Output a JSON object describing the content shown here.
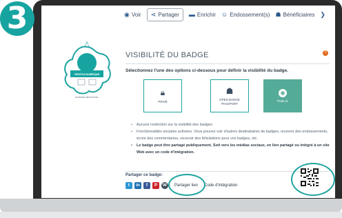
{
  "step": {
    "number": "3"
  },
  "nav": {
    "items": [
      {
        "label": "Voir",
        "icon": "eye-icon"
      },
      {
        "label": "Partager",
        "icon": "share-icon",
        "active": true
      },
      {
        "label": "Enrichir",
        "icon": "folder-icon"
      },
      {
        "label": "Endossement(s)",
        "icon": "endorsement-icon"
      },
      {
        "label": "Bénéficiaires",
        "icon": "users-icon"
      }
    ]
  },
  "badge": {
    "top_text": "CRÉATION NUMÉRIQUE",
    "bottom_text": "EN BOOK PROTOTYPE"
  },
  "visibility": {
    "title": "VISIBILITÉ DU BADGE",
    "instruction": "Sélectionnez l'une des options ci-dessous pour définir la visibilité du badge.",
    "options": [
      {
        "label": "PRIVÉ",
        "icon": "lock-icon"
      },
      {
        "label_line1": "OPEN BADGE",
        "label_line2": "PASSPORT",
        "icon": "users-icon"
      },
      {
        "label": "PUBLIC",
        "icon": "globe-icon",
        "selected": true
      }
    ],
    "bullets": [
      "Aucune restriction sur la visibilité des badges.",
      "Fonctionnalités sociales activées. Vous pouvez voir d'autres destinataires de badges, recevoir des endossements, écrire des commentaires, recevoir des félicitations pour vos badges, etc.",
      "Le badge peut être partagé publiquement. Soit vers les médias sociaux, en lien partagé ou intégré à un site Web avec un code d'intégration."
    ]
  },
  "share": {
    "label": "Partager ce badge:",
    "link_label": "Partager lien",
    "embed_label": "Code d'intégration",
    "social": [
      {
        "name": "twitter-icon",
        "glyph": "t",
        "color": "#2a96d6"
      },
      {
        "name": "linkedin-icon",
        "glyph": "in",
        "color": "#1f6fb1"
      },
      {
        "name": "facebook-icon",
        "glyph": "f",
        "color": "#3b5a98"
      },
      {
        "name": "pinterest-icon",
        "glyph": "P",
        "color": "#cf2329"
      },
      {
        "name": "wordpress-icon",
        "glyph": "W",
        "color": "#3c4b57"
      }
    ]
  },
  "colors": {
    "teal": "#1ea3a0",
    "public_selected": "#54ab98",
    "badge_teal": "#17a4a1"
  }
}
